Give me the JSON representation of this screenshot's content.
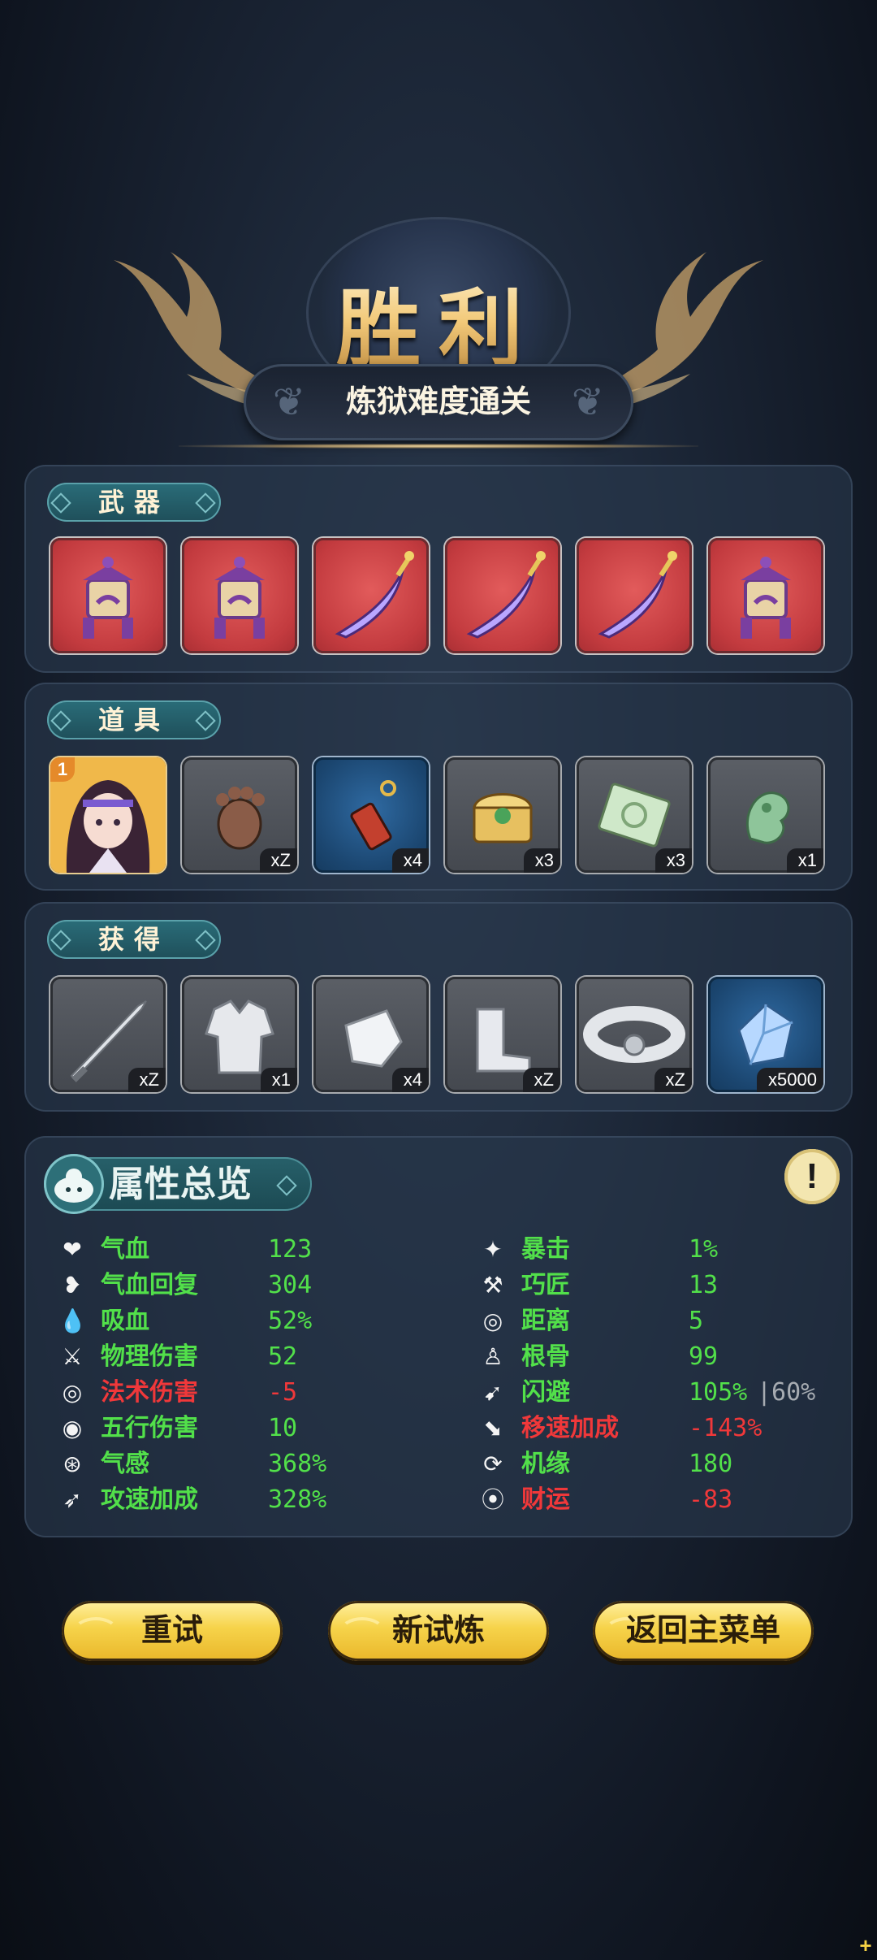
{
  "header": {
    "title": "胜利",
    "subtitle": "炼狱难度通关"
  },
  "sections": {
    "weapons": {
      "label": "武器",
      "items": [
        {
          "icon": "purple-lantern-icon",
          "bg": "red"
        },
        {
          "icon": "purple-lantern-icon",
          "bg": "red"
        },
        {
          "icon": "purple-curved-blade-icon",
          "bg": "red"
        },
        {
          "icon": "purple-curved-blade-icon",
          "bg": "red"
        },
        {
          "icon": "purple-curved-blade-icon",
          "bg": "red"
        },
        {
          "icon": "purple-lantern-icon",
          "bg": "red"
        }
      ]
    },
    "props": {
      "label": "道具",
      "items": [
        {
          "icon": "hero-portrait",
          "bg": "gold",
          "badge": "1"
        },
        {
          "icon": "bear-paw-icon",
          "bg": "grey",
          "qty": "xZ"
        },
        {
          "icon": "red-talisman-icon",
          "bg": "blue",
          "qty": "x4"
        },
        {
          "icon": "golden-chest-icon",
          "bg": "grey",
          "qty": "x3"
        },
        {
          "icon": "jade-scroll-icon",
          "bg": "grey",
          "qty": "x3"
        },
        {
          "icon": "jade-pendant-icon",
          "bg": "grey",
          "qty": "x1"
        }
      ]
    },
    "obtained": {
      "label": "获得",
      "items": [
        {
          "icon": "sword-icon",
          "bg": "grey",
          "qty": "xZ"
        },
        {
          "icon": "robe-icon",
          "bg": "grey",
          "qty": "x1"
        },
        {
          "icon": "bracer-icon",
          "bg": "grey",
          "qty": "x4"
        },
        {
          "icon": "boots-icon",
          "bg": "grey",
          "qty": "xZ"
        },
        {
          "icon": "belt-icon",
          "bg": "grey",
          "qty": "xZ"
        },
        {
          "icon": "blue-crystal-icon",
          "bg": "blue",
          "qty": "x5000"
        }
      ]
    }
  },
  "stats": {
    "title": "属性总览",
    "left": [
      {
        "icon": "heart-icon",
        "label": "气血",
        "value": "123",
        "color": "green"
      },
      {
        "icon": "heart-regen-icon",
        "label": "气血回复",
        "value": "304",
        "color": "green"
      },
      {
        "icon": "blood-drop-icon",
        "label": "吸血",
        "value": "52%",
        "color": "green"
      },
      {
        "icon": "sword-slash-icon",
        "label": "物理伤害",
        "value": "52",
        "color": "green"
      },
      {
        "icon": "spiral-icon",
        "label": "法术伤害",
        "value": "-5",
        "color": "red"
      },
      {
        "icon": "five-elements-icon",
        "label": "五行伤害",
        "value": "10",
        "color": "green"
      },
      {
        "icon": "qi-sense-icon",
        "label": "气感",
        "value": "368%",
        "color": "green"
      },
      {
        "icon": "attack-speed-icon",
        "label": "攻速加成",
        "value": "328%",
        "color": "green"
      }
    ],
    "right": [
      {
        "icon": "crit-icon",
        "label": "暴击",
        "value": "1%",
        "color": "green"
      },
      {
        "icon": "hammer-icon",
        "label": "巧匠",
        "value": "13",
        "color": "green"
      },
      {
        "icon": "target-icon",
        "label": "距离",
        "value": "5",
        "color": "green"
      },
      {
        "icon": "meditate-icon",
        "label": "根骨",
        "value": "99",
        "color": "green"
      },
      {
        "icon": "dodge-icon",
        "label": "闪避",
        "value": "105%",
        "extra": "|60%",
        "color": "green"
      },
      {
        "icon": "boot-speed-icon",
        "label": "移速加成",
        "value": "-143%",
        "color": "red"
      },
      {
        "icon": "luck-cycle-icon",
        "label": "机缘",
        "value": "180",
        "color": "green"
      },
      {
        "icon": "coin-icon",
        "label": "财运",
        "value": "-83",
        "color": "red"
      }
    ]
  },
  "buttons": {
    "retry": "重试",
    "new_trial": "新试炼",
    "main_menu": "返回主菜单"
  },
  "colors": {
    "positive": "#52e04a",
    "negative": "#f0383a",
    "button": "#f6d34a",
    "tag": "#2a6d79"
  }
}
